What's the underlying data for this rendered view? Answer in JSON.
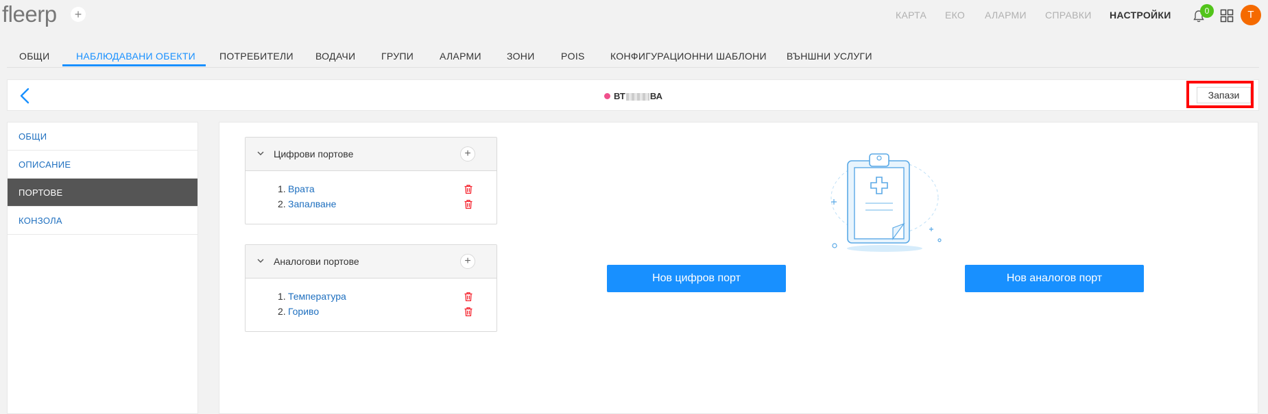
{
  "app": {
    "logo": "fleerp",
    "logo_plus": "+"
  },
  "topnav": [
    {
      "label": "КАРТА"
    },
    {
      "label": "ЕКО"
    },
    {
      "label": "АЛАРМИ"
    },
    {
      "label": "СПРАВКИ"
    },
    {
      "label": "НАСТРОЙКИ"
    }
  ],
  "notifications": {
    "count": "0"
  },
  "user": {
    "initial": "T",
    "avatar_color": "#f56a00"
  },
  "tabs": [
    {
      "label": "ОБЩИ"
    },
    {
      "label": "НАБЛЮДАВАНИ ОБЕКТИ"
    },
    {
      "label": "ПОТРЕБИТЕЛИ"
    },
    {
      "label": "ВОДАЧИ"
    },
    {
      "label": "ГРУПИ"
    },
    {
      "label": "АЛАРМИ"
    },
    {
      "label": "ЗОНИ"
    },
    {
      "label": "POIS"
    },
    {
      "label": "КОНФИГУРАЦИОННИ ШАБЛОНИ"
    },
    {
      "label": "ВЪНШНИ УСЛУГИ"
    }
  ],
  "active_tab": "НАБЛЮДАВАНИ ОБЕКТИ",
  "header": {
    "title_prefix": "ВТ",
    "title_suffix": "ВА",
    "status_color": "#f0508c",
    "save_label": "Запази"
  },
  "sidebar": {
    "items": [
      {
        "label": "ОБЩИ"
      },
      {
        "label": "ОПИСАНИЕ"
      },
      {
        "label": "ПОРТОВЕ"
      },
      {
        "label": "КОНЗОЛА"
      }
    ],
    "active": "ПОРТОВЕ"
  },
  "digital_ports": {
    "title": "Цифрови портове",
    "add": "+",
    "items": [
      {
        "num": "1.",
        "name": "Врата"
      },
      {
        "num": "2.",
        "name": "Запалване"
      }
    ]
  },
  "analog_ports": {
    "title": "Аналогови портове",
    "add": "+",
    "items": [
      {
        "num": "1.",
        "name": "Температура"
      },
      {
        "num": "2.",
        "name": "Гориво"
      }
    ]
  },
  "actions": {
    "new_digital": "Нов цифров порт",
    "new_analog": "Нов аналогов порт"
  },
  "colors": {
    "accent": "#1890ff",
    "link": "#1e6fbf",
    "delete": "#f5222d",
    "highlight": "#ff0000",
    "badge": "#52c41a"
  }
}
